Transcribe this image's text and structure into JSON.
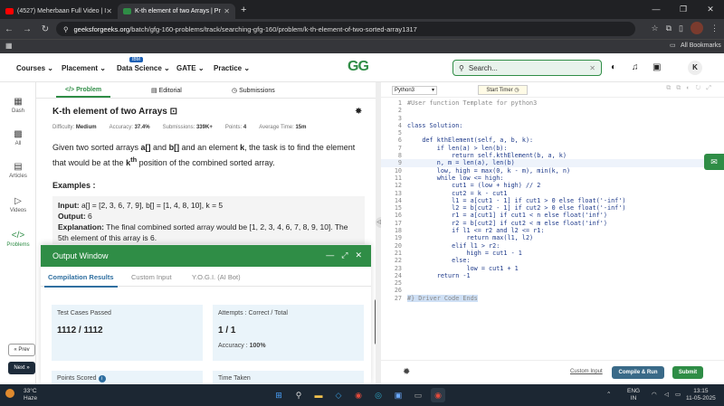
{
  "browser": {
    "tabs": [
      {
        "title": "(4527) Meherbaan Full Video | I",
        "color": "#ff0000"
      },
      {
        "title": "K-th element of two Arrays | Pr",
        "color": "#2f8d46"
      }
    ],
    "url_domain": "geeksforgeeks.org",
    "url_path": "/batch/gfg-160-problems/track/searching-gfg-160/problem/k-th-element-of-two-sorted-array1317",
    "bookmarks_label": "All Bookmarks"
  },
  "nav": {
    "items": [
      "Courses",
      "Placement",
      "Data Science",
      "GATE",
      "Practice"
    ],
    "ibm_badge": "IBM",
    "logo": "GG",
    "search_placeholder": "Search...",
    "avatar_letter": "K"
  },
  "sidebar": {
    "items": [
      "Dash",
      "All",
      "Articles",
      "Videos",
      "Problems"
    ],
    "prev_label": "« Prev",
    "next_label": "Next »"
  },
  "left_tabs": [
    "Problem",
    "Editorial",
    "Submissions"
  ],
  "problem": {
    "title": "K-th element of two Arrays",
    "difficulty_label": "Difficulty:",
    "difficulty": "Medium",
    "accuracy_label": "Accuracy:",
    "accuracy": "37.4%",
    "submissions_label": "Submissions:",
    "submissions": "339K+",
    "points_label": "Points:",
    "points": "4",
    "time_label": "Average Time:",
    "time": "15m",
    "desc_1": "Given two sorted arrays ",
    "desc_a": "a[]",
    "desc_2": " and ",
    "desc_b": "b[]",
    "desc_3": " and an element ",
    "desc_k": "k",
    "desc_4": ", the task is to find the element that would be at the ",
    "desc_kth_k": "k",
    "desc_kth_th": "th",
    "desc_5": " position of the combined sorted array.",
    "examples_heading": "Examples :",
    "input_label": "Input:",
    "input_value": " a[] = [2, 3, 6, 7, 9], b[] = [1, 4, 8, 10], k = 5",
    "output_label": "Output:",
    "output_value": " 6",
    "explanation_label": "Explanation:",
    "explanation_value": " The final combined sorted array would be [1, 2, 3, 4, 6, 7, 8, 9, 10]. The 5th element of this array is 6."
  },
  "output_window": {
    "title": "Output Window",
    "tabs": [
      "Compilation Results",
      "Custom Input",
      "Y.O.G.I. (AI Bot)"
    ],
    "test_cases_label": "Test Cases Passed",
    "test_cases_value": "1112 / 1112",
    "attempts_label": "Attempts : Correct / Total",
    "attempts_value": "1 / 1",
    "accuracy_label": "Accuracy :",
    "accuracy_value": "100%",
    "points_label": "Points Scored",
    "time_label": "Time Taken"
  },
  "editor": {
    "language": "Python3",
    "timer_label": "Start Timer",
    "lines": [
      {
        "n": "1",
        "t": "#User function Template for python3",
        "c": "cm"
      },
      {
        "n": "2",
        "t": "",
        "c": ""
      },
      {
        "n": "3",
        "t": "",
        "c": ""
      },
      {
        "n": "4",
        "t": "class Solution:",
        "c": ""
      },
      {
        "n": "5",
        "t": "",
        "c": ""
      },
      {
        "n": "6",
        "t": "    def kthElement(self, a, b, k):",
        "c": ""
      },
      {
        "n": "7",
        "t": "        if len(a) > len(b):",
        "c": ""
      },
      {
        "n": "8",
        "t": "            return self.kthElement(b, a, k)",
        "c": ""
      },
      {
        "n": "9",
        "t": "        n, m = len(a), len(b)",
        "c": ""
      },
      {
        "n": "10",
        "t": "        low, high = max(0, k - m), min(k, n)",
        "c": ""
      },
      {
        "n": "11",
        "t": "        while low <= high:",
        "c": ""
      },
      {
        "n": "12",
        "t": "            cut1 = (low + high) // 2",
        "c": ""
      },
      {
        "n": "13",
        "t": "            cut2 = k - cut1",
        "c": ""
      },
      {
        "n": "14",
        "t": "            l1 = a[cut1 - 1] if cut1 > 0 else float('-inf')",
        "c": ""
      },
      {
        "n": "15",
        "t": "            l2 = b[cut2 - 1] if cut2 > 0 else float('-inf')",
        "c": ""
      },
      {
        "n": "16",
        "t": "            r1 = a[cut1] if cut1 < n else float('inf')",
        "c": ""
      },
      {
        "n": "17",
        "t": "            r2 = b[cut2] if cut2 < m else float('inf')",
        "c": ""
      },
      {
        "n": "18",
        "t": "            if l1 <= r2 and l2 <= r1:",
        "c": ""
      },
      {
        "n": "19",
        "t": "                return max(l1, l2)",
        "c": ""
      },
      {
        "n": "20",
        "t": "            elif l1 > r2:",
        "c": ""
      },
      {
        "n": "21",
        "t": "                high = cut1 - 1",
        "c": ""
      },
      {
        "n": "22",
        "t": "            else:",
        "c": ""
      },
      {
        "n": "23",
        "t": "                low = cut1 + 1",
        "c": ""
      },
      {
        "n": "24",
        "t": "        return -1",
        "c": ""
      },
      {
        "n": "25",
        "t": "",
        "c": ""
      },
      {
        "n": "26",
        "t": "",
        "c": ""
      },
      {
        "n": "27",
        "t": "#} Driver Code Ends",
        "c": "cm"
      }
    ],
    "custom_input_label": "Custom Input",
    "compile_label": "Compile & Run",
    "submit_label": "Submit"
  },
  "taskbar": {
    "temp": "33°C",
    "weather": "Haze",
    "lang": "ENG",
    "region": "IN",
    "time": "13:15",
    "date": "11-05-2025"
  },
  "colors": {
    "brand": "#2f8d46",
    "accent": "#2f6fa0"
  }
}
